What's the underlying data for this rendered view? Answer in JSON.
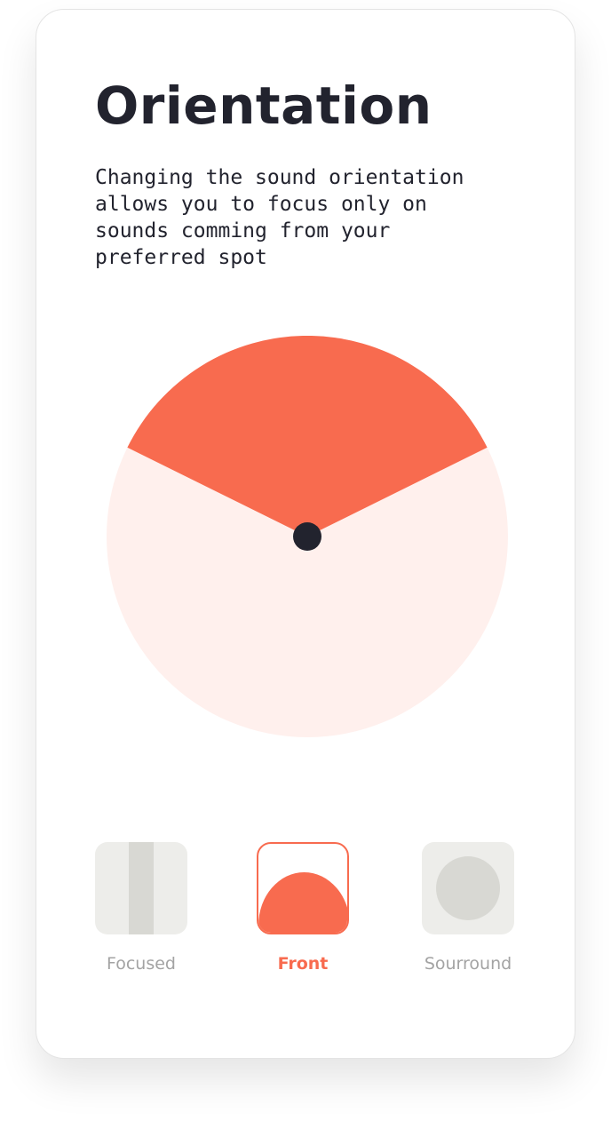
{
  "screen": {
    "title": "Orientation",
    "description": "Changing the sound orientation\nallows you to focus only on\nsounds comming from your\npreferred spot"
  },
  "orientation_dial": {
    "selected_sector": "front",
    "icon": "orientation-dial"
  },
  "modes": [
    {
      "label": "Focused",
      "icon": "focused-bar-icon",
      "selected": false
    },
    {
      "label": "Front",
      "icon": "front-half-circle-icon",
      "selected": true
    },
    {
      "label": "Sourround",
      "icon": "surround-circle-icon",
      "selected": false
    }
  ],
  "colors": {
    "accent": "#f86b4f",
    "accent_light": "#fff0ed",
    "dark": "#22232e",
    "inactive_tile": "#ededea",
    "inactive_shape": "#d8d8d3",
    "inactive_label": "#a3a3a3"
  }
}
